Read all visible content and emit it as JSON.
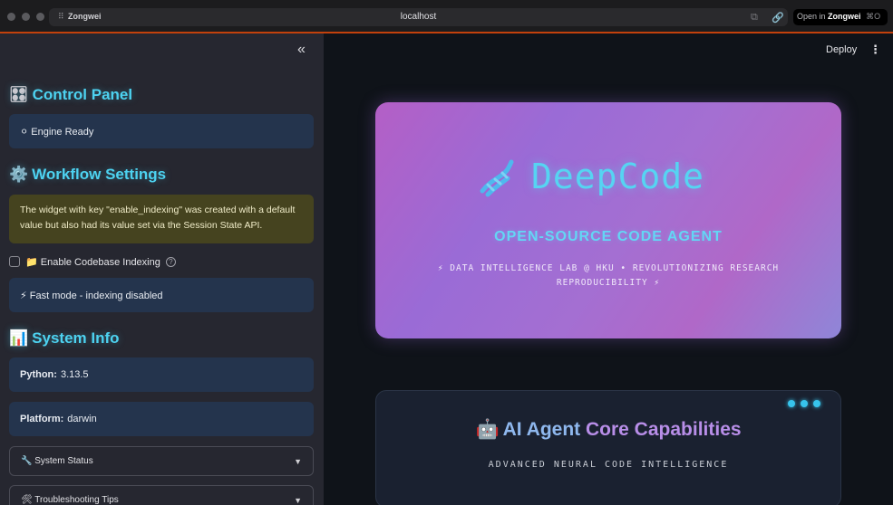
{
  "browser": {
    "tab_name": "Zongwei",
    "url": "localhost",
    "open_in_label": "Open in",
    "open_in_app": "Zongwei",
    "open_in_shortcut": "⌘O"
  },
  "sidebar": {
    "collapse_glyph": "«",
    "control_panel": {
      "emoji": "🎛",
      "title": "Control Panel"
    },
    "engine_status": "⚪ Engine Ready",
    "workflow": {
      "emoji": "⚙️",
      "title": "Workflow Settings"
    },
    "warning": "The widget with key \"enable_indexing\" was created with a default value but also had its value set via the Session State API.",
    "indexing_checkbox": {
      "label": "📁 Enable Codebase Indexing",
      "checked": false
    },
    "indexing_status": "⚡ Fast mode - indexing disabled",
    "system_info": {
      "emoji": "📊",
      "title": "System Info"
    },
    "python": {
      "label": "Python:",
      "value": "3.13.5"
    },
    "platform": {
      "label": "Platform:",
      "value": "darwin"
    },
    "expanders": [
      {
        "label": "🔧 System Status"
      },
      {
        "label": "🛠 Troubleshooting Tips"
      }
    ]
  },
  "main": {
    "deploy_label": "Deploy",
    "hero": {
      "title": "DeepCode",
      "subtitle": "OPEN-SOURCE CODE AGENT",
      "tagline": "⚡ DATA INTELLIGENCE LAB @ HKU • REVOLUTIONIZING RESEARCH REPRODUCIBILITY ⚡"
    },
    "capabilities": {
      "emoji": "🤖",
      "title_part1": "AI Agent",
      "title_part2": "Core Capabilities",
      "subtitle": "ADVANCED NEURAL CODE INTELLIGENCE"
    }
  },
  "colors": {
    "accent_cyan": "#4dd2f0",
    "hero_gradient_start": "#b45fc6",
    "hero_gradient_end": "#8f86d8",
    "warning_bg": "#45431f",
    "info_card_bg": "#24344d"
  }
}
